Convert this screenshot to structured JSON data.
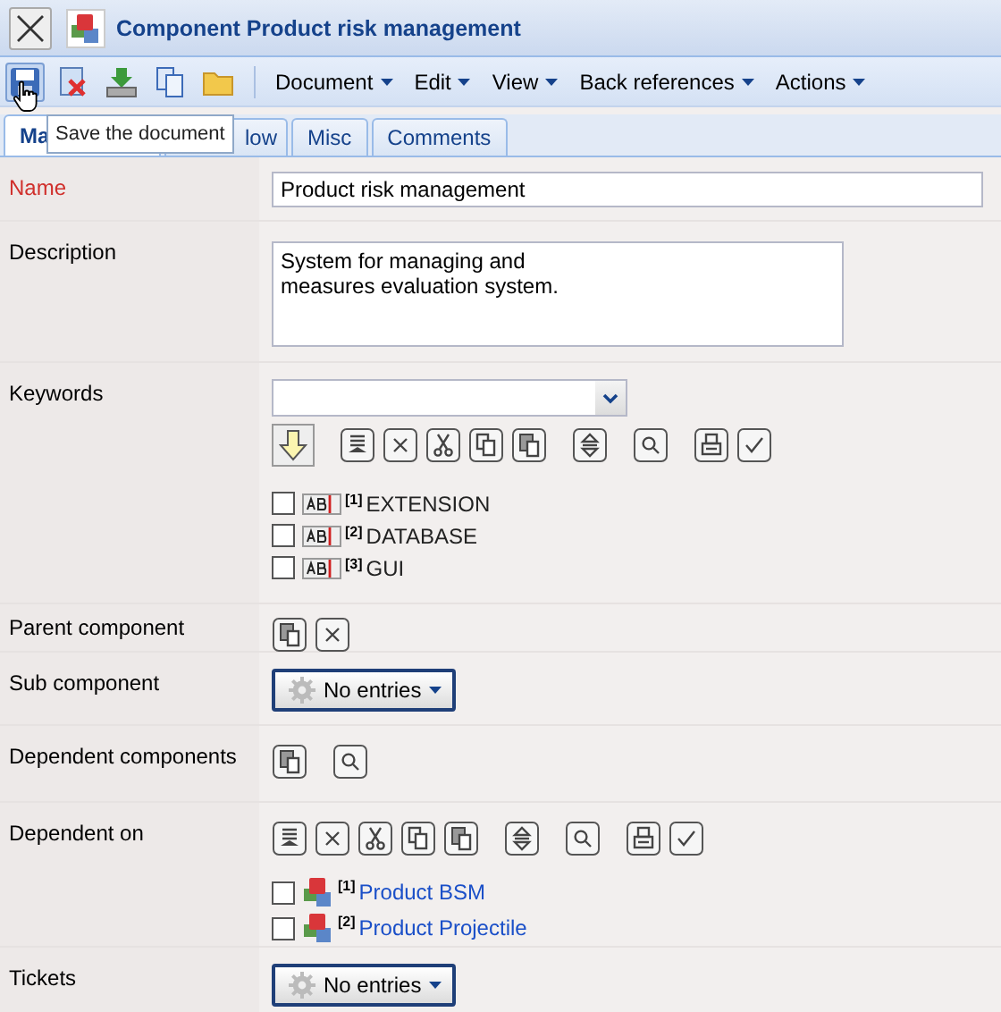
{
  "window": {
    "title": "Component Product risk management"
  },
  "menus": [
    {
      "label": "Document"
    },
    {
      "label": "Edit"
    },
    {
      "label": "View"
    },
    {
      "label": "Back references"
    },
    {
      "label": "Actions"
    }
  ],
  "tooltip": "Save the document",
  "tabs": [
    {
      "label": "Ma",
      "selected": true
    },
    {
      "label": "low",
      "selected": false
    },
    {
      "label": "Misc",
      "selected": false
    },
    {
      "label": "Comments",
      "selected": false
    }
  ],
  "rows": [
    {
      "label": "Name",
      "required": true,
      "kind": "text",
      "value": "Product risk management"
    },
    {
      "label": "Description",
      "required": false,
      "kind": "textarea",
      "value": "System for managing and\nmeasures evaluation system."
    },
    {
      "label": "Keywords",
      "required": false,
      "kind": "keywords",
      "items": [
        {
          "index": "[1]",
          "text": "EXTENSION",
          "checked": false
        },
        {
          "index": "[2]",
          "text": "DATABASE",
          "checked": false
        },
        {
          "index": "[3]",
          "text": "GUI",
          "checked": false
        }
      ]
    },
    {
      "label": "Parent component",
      "required": false,
      "kind": "parent"
    },
    {
      "label": "Sub component",
      "required": false,
      "kind": "dropdown",
      "value": "No entries"
    },
    {
      "label": "Dependent components",
      "required": false,
      "kind": "dependents"
    },
    {
      "label": "Dependent on",
      "required": false,
      "kind": "references",
      "items": [
        {
          "index": "[1]",
          "text": "Product BSM",
          "checked": false
        },
        {
          "index": "[2]",
          "text": "Product Projectile",
          "checked": false
        }
      ]
    },
    {
      "label": "Tickets",
      "required": false,
      "kind": "dropdown",
      "value": "No entries"
    }
  ]
}
